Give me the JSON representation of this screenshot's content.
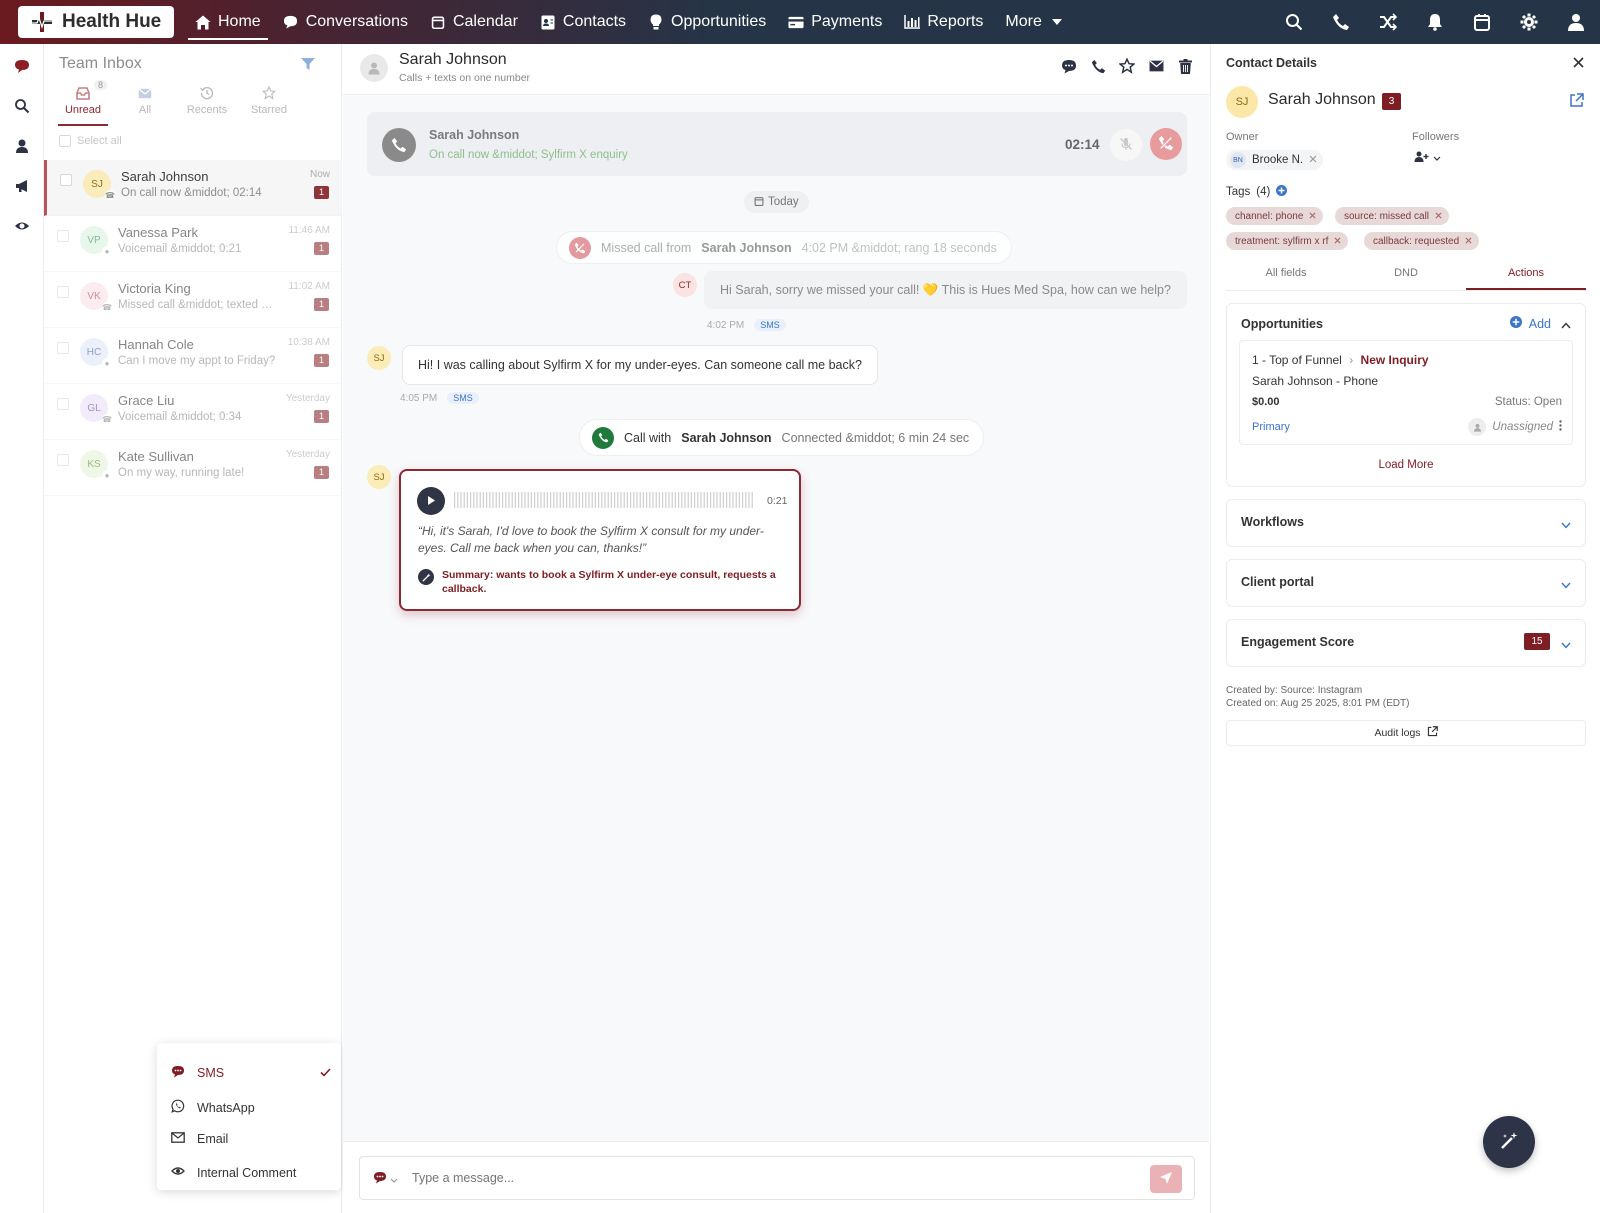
{
  "brand": {
    "name": "Health Hue",
    "accent": "#7e1d24",
    "nav_bg": "#253447"
  },
  "nav": {
    "items": [
      {
        "label": "Home",
        "icon": "home-icon",
        "active": true
      },
      {
        "label": "Conversations",
        "icon": "chat-icon"
      },
      {
        "label": "Calendar",
        "icon": "calendar-icon"
      },
      {
        "label": "Contacts",
        "icon": "contact-card-icon"
      },
      {
        "label": "Opportunities",
        "icon": "lightbulb-icon"
      },
      {
        "label": "Payments",
        "icon": "credit-card-icon"
      },
      {
        "label": "Reports",
        "icon": "bar-chart-icon"
      },
      {
        "label": "More",
        "icon": "caret-down-icon"
      }
    ],
    "right_icons": [
      "search-icon",
      "phone-icon",
      "shuffle-icon",
      "bell-icon",
      "calendar-icon",
      "gear-icon",
      "user-icon"
    ]
  },
  "inbox": {
    "title": "Team Inbox",
    "tabs": [
      {
        "label": "Unread",
        "count": "8",
        "active": true
      },
      {
        "label": "All"
      },
      {
        "label": "Recents"
      },
      {
        "label": "Starred"
      }
    ],
    "select_all": "Select all",
    "conversations": [
      {
        "initials": "SJ",
        "name": "Sarah Johnson",
        "preview": "On call now &middot; 02:14",
        "time": "Now",
        "badge": "1",
        "avatar_bg": "#fbecb8",
        "avatar_fg": "#8a6a10"
      },
      {
        "initials": "VP",
        "name": "Vanessa Park",
        "preview": "Voicemail &middot; 0:21",
        "time": "11:46 AM",
        "badge": "1",
        "avatar_bg": "#d9f2de",
        "avatar_fg": "#3a8a4a"
      },
      {
        "initials": "VK",
        "name": "Victoria King",
        "preview": "Missed call &middot; texted back",
        "time": "11:02 AM",
        "badge": "1",
        "avatar_bg": "#fbe0e6",
        "avatar_fg": "#a0405a"
      },
      {
        "initials": "HC",
        "name": "Hannah Cole",
        "preview": "Can I move my appt to Friday?",
        "time": "10:38 AM",
        "badge": "1",
        "avatar_bg": "#dfe7f8",
        "avatar_fg": "#3a5ea8"
      },
      {
        "initials": "GL",
        "name": "Grace Liu",
        "preview": "Voicemail &middot; 0:34",
        "time": "Yesterday",
        "badge": "1",
        "avatar_bg": "#ebe1f7",
        "avatar_fg": "#6a4aa0"
      },
      {
        "initials": "KS",
        "name": "Kate Sullivan",
        "preview": "On my way, running late!",
        "time": "Yesterday",
        "badge": "1",
        "avatar_bg": "#e6f4d6",
        "avatar_fg": "#5a8a2a"
      }
    ]
  },
  "channel_menu": {
    "items": [
      {
        "label": "SMS",
        "icon": "sms-icon",
        "selected": true
      },
      {
        "label": "WhatsApp",
        "icon": "whatsapp-icon"
      },
      {
        "label": "Email",
        "icon": "envelope-icon"
      },
      {
        "label": "Internal Comment",
        "icon": "eye-icon"
      }
    ]
  },
  "chat": {
    "contact_name": "Sarah Johnson",
    "contact_sub": "Calls + texts on one number",
    "call_bar": {
      "name": "Sarah Johnson",
      "status": "On call now &middot; Sylfirm X enquiry",
      "timer": "02:14"
    },
    "today_label": "Today",
    "missed_call": {
      "prefix": "Missed call from",
      "name": "Sarah Johnson",
      "meta": "4:02 PM &middot; rang 18 seconds"
    },
    "outgoing": {
      "avatar": "CT",
      "text": "Hi Sarah, sorry we missed your call! 💛 This is Hues Med Spa, how can we help?",
      "time": "4:02 PM",
      "channel": "SMS"
    },
    "incoming": {
      "avatar": "SJ",
      "text": "Hi! I was calling about Sylfirm X for my under-eyes. Can someone call me back?",
      "time": "4:05 PM",
      "channel": "SMS"
    },
    "call_with": {
      "prefix": "Call with",
      "name": "Sarah Johnson",
      "meta": "Connected &middot; 6 min 24 sec"
    },
    "voicemail": {
      "avatar": "SJ",
      "duration": "0:21",
      "quote": "“Hi, it's Sarah, I'd love to book the Sylfirm X consult for my under-eyes. Call me back when you can, thanks!”",
      "summary": "Summary: wants to book a Sylfirm X under-eye consult, requests a callback."
    },
    "composer_placeholder": "Type a message..."
  },
  "contact": {
    "panel_title": "Contact Details",
    "initials": "SJ",
    "name": "Sarah Johnson",
    "badge": "3",
    "owner_label": "Owner",
    "owner_initials": "BN",
    "owner_name": "Brooke N.",
    "followers_label": "Followers",
    "tags_title": "Tags",
    "tags_count": "(4)",
    "tags": [
      "channel: phone",
      "source: missed call",
      "treatment: sylfirm x rf",
      "callback: requested"
    ],
    "tabs": [
      {
        "label": "All fields"
      },
      {
        "label": "DND"
      },
      {
        "label": "Actions",
        "active": true
      }
    ],
    "opportunities": {
      "title": "Opportunities",
      "add_label": "Add",
      "stage": "1 - Top of Funnel",
      "stage_sep": "›",
      "status_name": "New Inquiry",
      "name": "Sarah Johnson - Phone",
      "value": "$0.00",
      "status": "Status: Open",
      "primary": "Primary",
      "assignee": "Unassigned",
      "load_more": "Load More"
    },
    "workflows_title": "Workflows",
    "portal_title": "Client portal",
    "engagement_title": "Engagement Score",
    "engagement_score": "15",
    "created_by": "Created by: Source: Instagram",
    "created_on": "Created on: Aug 25 2025, 8:01 PM (EDT)",
    "audit_label": "Audit logs"
  }
}
